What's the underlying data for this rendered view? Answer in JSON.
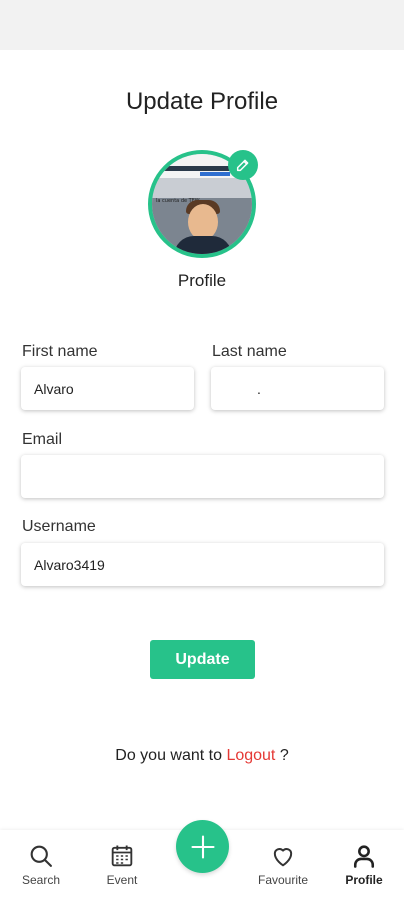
{
  "page": {
    "title": "Update Profile",
    "avatar_label": "Profile"
  },
  "avatar": {
    "tiny_text": "la cuenta de TFW"
  },
  "form": {
    "first_name_label": "First name",
    "first_name_value": "Alvaro",
    "last_name_label": "Last name",
    "last_name_value": ".",
    "email_label": "Email",
    "email_value": "",
    "username_label": "Username",
    "username_value": "Alvaro3419",
    "update_label": "Update"
  },
  "logout": {
    "prompt": "Do you want to ",
    "link": "Logout",
    "suffix": " ?"
  },
  "nav": {
    "items": [
      {
        "label": "Search",
        "icon": "search-icon"
      },
      {
        "label": "Event",
        "icon": "calendar-icon"
      },
      {
        "label": "Favourite",
        "icon": "heart-icon"
      },
      {
        "label": "Profile",
        "icon": "person-icon",
        "active": true
      }
    ],
    "fab_icon": "plus-icon"
  },
  "colors": {
    "accent": "#27c28a",
    "logout": "#e53935"
  }
}
